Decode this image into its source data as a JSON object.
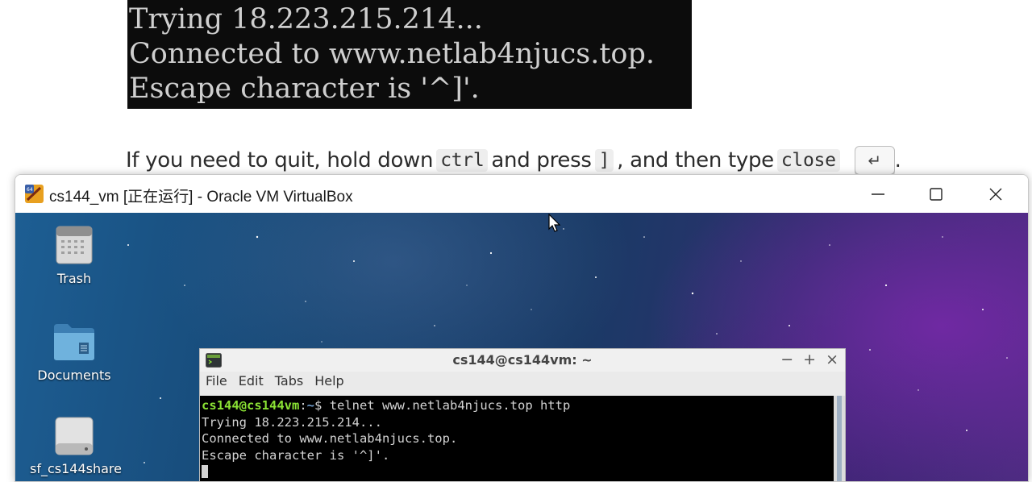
{
  "document": {
    "code_lines": [
      "Trying 18.223.215.214...",
      "Connected to www.netlab4njucs.top.",
      "Escape character is '^]'."
    ],
    "quit_text_1": "If you need to quit, hold down",
    "quit_code_1": "ctrl",
    "quit_text_2": "and press",
    "quit_code_2": "]",
    "quit_text_3": ", and then type",
    "quit_code_3": "close",
    "quit_key_glyph": "↵",
    "quit_text_end": "."
  },
  "vbox": {
    "title": "cs144_vm [正在运行] - Oracle VM VirtualBox",
    "icons": {
      "minimize": "minimize-icon",
      "maximize": "maximize-icon",
      "close": "close-icon"
    }
  },
  "desktop": {
    "icons": [
      {
        "label": "Trash",
        "icon": "trash-icon"
      },
      {
        "label": "Documents",
        "icon": "folder-icon"
      },
      {
        "label": "sf_cs144share",
        "icon": "drive-icon"
      }
    ]
  },
  "terminal": {
    "title": "cs144@cs144vm: ~",
    "controls": [
      "−",
      "+",
      "×"
    ],
    "menu": [
      "File",
      "Edit",
      "Tabs",
      "Help"
    ],
    "prompt_user": "cs144@cs144vm",
    "prompt_sep": ":",
    "prompt_path": "~",
    "prompt_symbol": "$ ",
    "command": "telnet www.netlab4njucs.top http",
    "output": [
      "Trying 18.223.215.214...",
      "Connected to www.netlab4njucs.top.",
      "Escape character is '^]'."
    ]
  }
}
